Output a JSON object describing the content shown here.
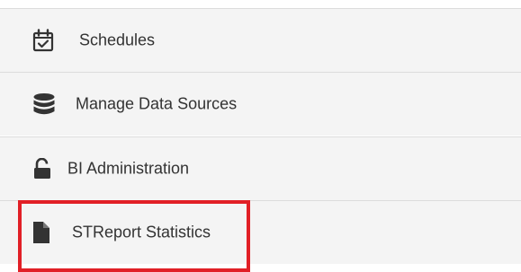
{
  "menu": {
    "items": [
      {
        "label": "Schedules",
        "icon": "calendar-check-icon"
      },
      {
        "label": "Manage Data Sources",
        "icon": "database-icon"
      },
      {
        "label": "BI Administration",
        "icon": "unlock-icon"
      },
      {
        "label": "STReport Statistics",
        "icon": "file-icon"
      }
    ]
  },
  "colors": {
    "item_background": "#f4f4f4",
    "divider": "#dcdcdc",
    "icon": "#333333",
    "text": "#333333",
    "highlight_border": "#e11f26"
  }
}
